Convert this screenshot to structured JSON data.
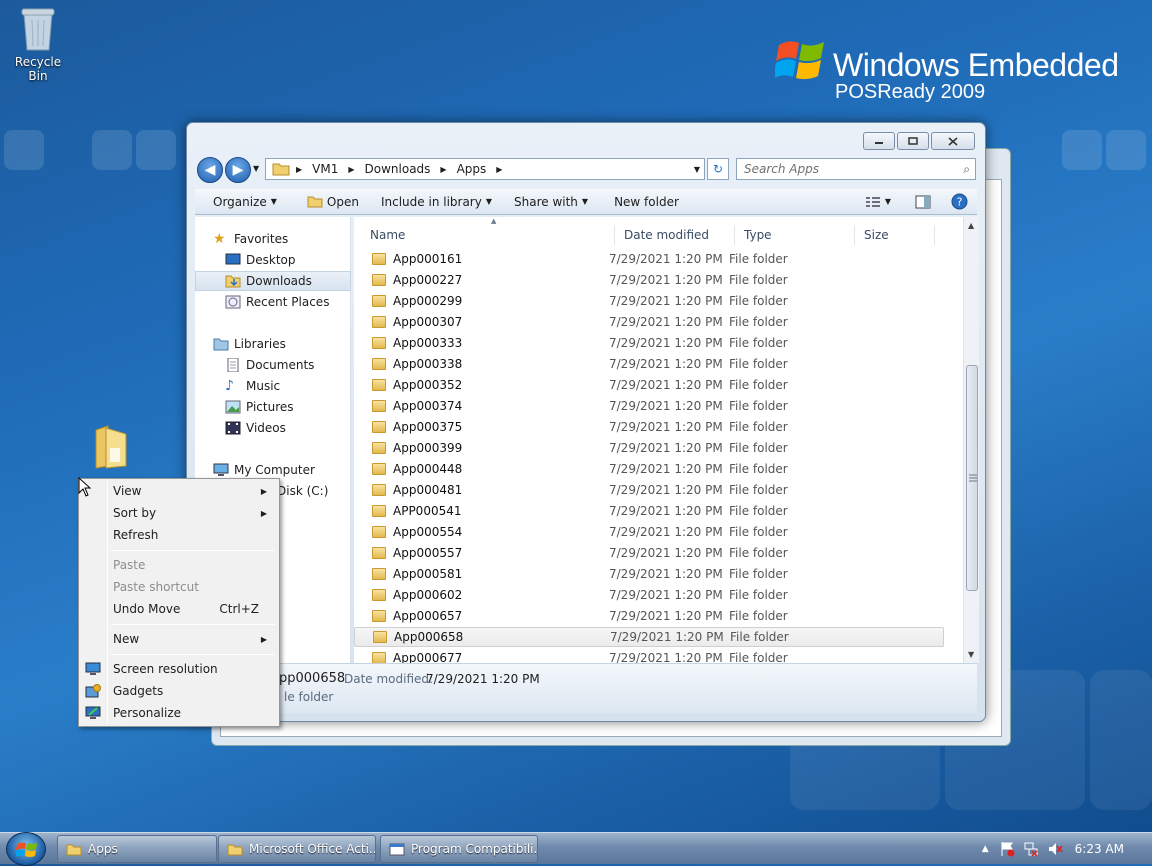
{
  "desktop": {
    "recycle_bin_label": "Recycle Bin",
    "brand": {
      "title": "Windows Embedded",
      "subtitle": "POSReady 2009"
    }
  },
  "explorer": {
    "breadcrumb": [
      "VM1",
      "Downloads",
      "Apps"
    ],
    "search_placeholder": "Search Apps",
    "toolbar": {
      "organize": "Organize",
      "open": "Open",
      "include_in_library": "Include in library",
      "share_with": "Share with",
      "new_folder": "New folder"
    },
    "nav": {
      "favorites": "Favorites",
      "desktop": "Desktop",
      "downloads": "Downloads",
      "recent_places": "Recent Places",
      "libraries": "Libraries",
      "documents": "Documents",
      "music": "Music",
      "pictures": "Pictures",
      "videos": "Videos",
      "my_computer": "My Computer",
      "local_disk": "Disk (C:)"
    },
    "columns": {
      "name": "Name",
      "date_modified": "Date modified",
      "type": "Type",
      "size": "Size"
    },
    "files": [
      {
        "name": "App000161",
        "date": "7/29/2021 1:20 PM",
        "type": "File folder"
      },
      {
        "name": "App000227",
        "date": "7/29/2021 1:20 PM",
        "type": "File folder"
      },
      {
        "name": "App000299",
        "date": "7/29/2021 1:20 PM",
        "type": "File folder"
      },
      {
        "name": "App000307",
        "date": "7/29/2021 1:20 PM",
        "type": "File folder"
      },
      {
        "name": "App000333",
        "date": "7/29/2021 1:20 PM",
        "type": "File folder"
      },
      {
        "name": "App000338",
        "date": "7/29/2021 1:20 PM",
        "type": "File folder"
      },
      {
        "name": "App000352",
        "date": "7/29/2021 1:20 PM",
        "type": "File folder"
      },
      {
        "name": "App000374",
        "date": "7/29/2021 1:20 PM",
        "type": "File folder"
      },
      {
        "name": "App000375",
        "date": "7/29/2021 1:20 PM",
        "type": "File folder"
      },
      {
        "name": "App000399",
        "date": "7/29/2021 1:20 PM",
        "type": "File folder"
      },
      {
        "name": "App000448",
        "date": "7/29/2021 1:20 PM",
        "type": "File folder"
      },
      {
        "name": "App000481",
        "date": "7/29/2021 1:20 PM",
        "type": "File folder"
      },
      {
        "name": "APP000541",
        "date": "7/29/2021 1:20 PM",
        "type": "File folder"
      },
      {
        "name": "App000554",
        "date": "7/29/2021 1:20 PM",
        "type": "File folder"
      },
      {
        "name": "App000557",
        "date": "7/29/2021 1:20 PM",
        "type": "File folder"
      },
      {
        "name": "App000581",
        "date": "7/29/2021 1:20 PM",
        "type": "File folder"
      },
      {
        "name": "App000602",
        "date": "7/29/2021 1:20 PM",
        "type": "File folder"
      },
      {
        "name": "App000657",
        "date": "7/29/2021 1:20 PM",
        "type": "File folder"
      },
      {
        "name": "App000658",
        "date": "7/29/2021 1:20 PM",
        "type": "File folder"
      },
      {
        "name": "App000677",
        "date": "7/29/2021 1:20 PM",
        "type": "File folder"
      }
    ],
    "selected_index": 18,
    "details": {
      "name": "pp000658",
      "date_label": "Date modified:",
      "date_value": "7/29/2021 1:20 PM",
      "type": "le folder"
    }
  },
  "context_menu": {
    "view": "View",
    "sort_by": "Sort by",
    "refresh": "Refresh",
    "paste": "Paste",
    "paste_shortcut": "Paste shortcut",
    "undo_move": "Undo Move",
    "undo_shortcut": "Ctrl+Z",
    "new": "New",
    "screen_resolution": "Screen resolution",
    "gadgets": "Gadgets",
    "personalize": "Personalize"
  },
  "taskbar": {
    "buttons": [
      "Apps",
      "Microsoft Office Acti...",
      "Program Compatibili..."
    ],
    "clock": "6:23 AM"
  }
}
